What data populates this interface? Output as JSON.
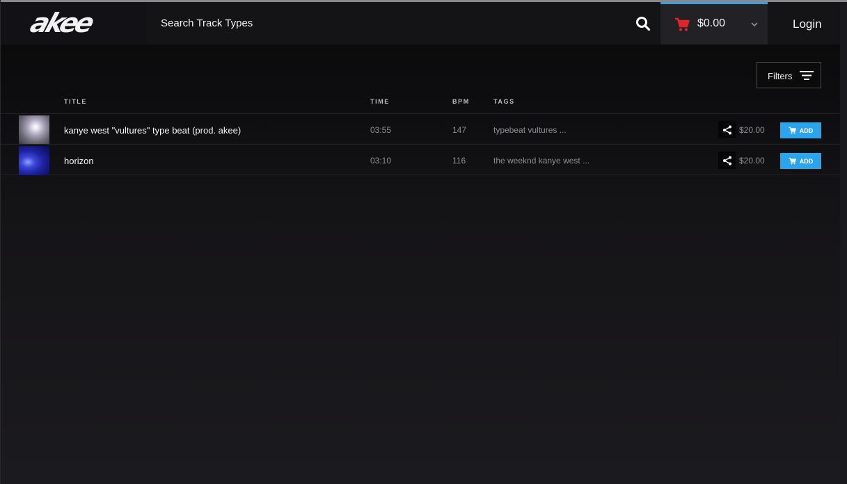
{
  "header": {
    "logo_text": "akee",
    "search_label": "Search Track Types",
    "cart_amount": "$0.00",
    "login_label": "Login"
  },
  "filters": {
    "label": "Filters"
  },
  "columns": {
    "title": "TITLE",
    "time": "TIME",
    "bpm": "BPM",
    "tags": "TAGS"
  },
  "tracks": [
    {
      "title": "kanye west \"vultures\" type beat (prod. akee)",
      "time": "03:55",
      "bpm": "147",
      "tags": "typebeat  vultures  ...",
      "price": "$20.00",
      "add_label": "ADD"
    },
    {
      "title": "horizon",
      "time": "03:10",
      "bpm": "116",
      "tags": "the weeknd  kanye west  ...",
      "price": "$20.00",
      "add_label": "ADD"
    }
  ],
  "colors": {
    "accent": "#2ba4ee",
    "cart_icon": "#e0262b",
    "cart_active_border": "#3aa0d9"
  }
}
